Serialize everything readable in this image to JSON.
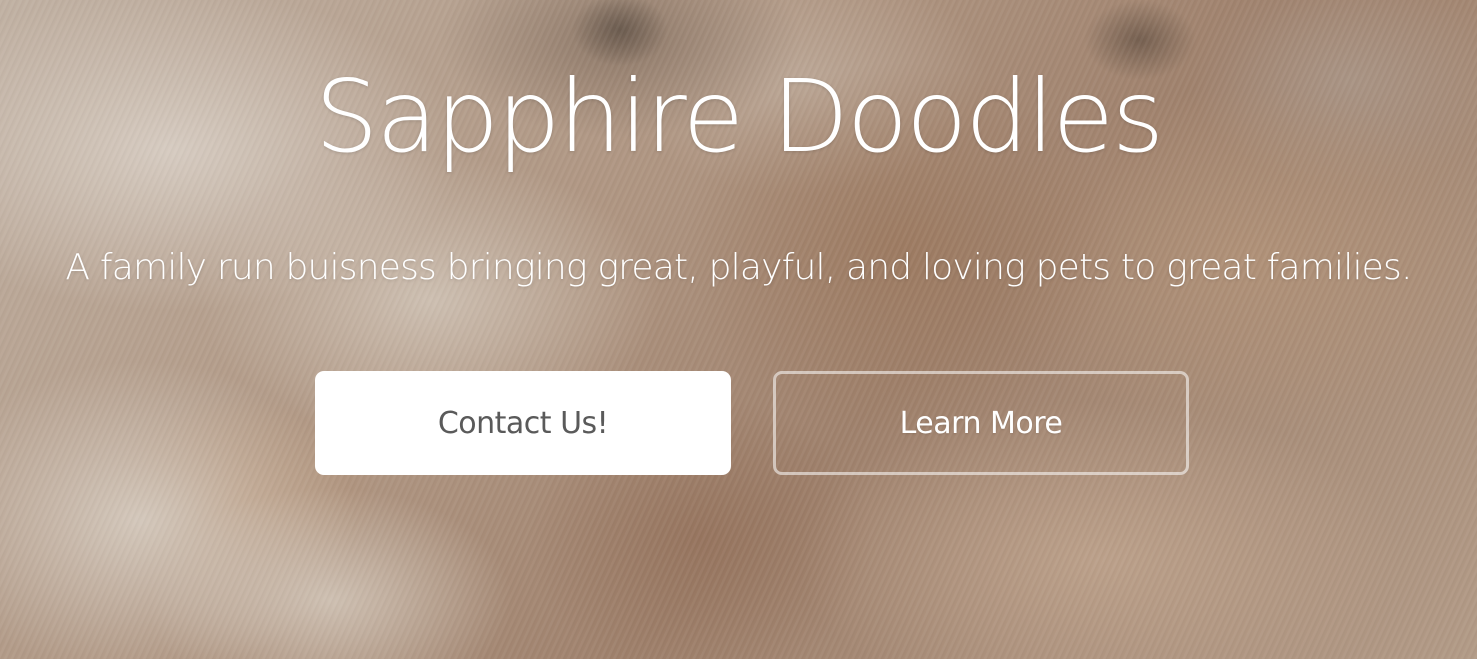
{
  "hero": {
    "title": "Sapphire Doodles",
    "subtitle": "A family run buisness bringing great, playful, and loving pets to great families.",
    "primary_button": "Contact Us!",
    "secondary_button": "Learn More"
  },
  "colors": {
    "text": "#ffffff",
    "primary_button_bg": "#ffffff",
    "primary_button_text": "#5a5a5a",
    "secondary_button_border": "#ffffff"
  }
}
